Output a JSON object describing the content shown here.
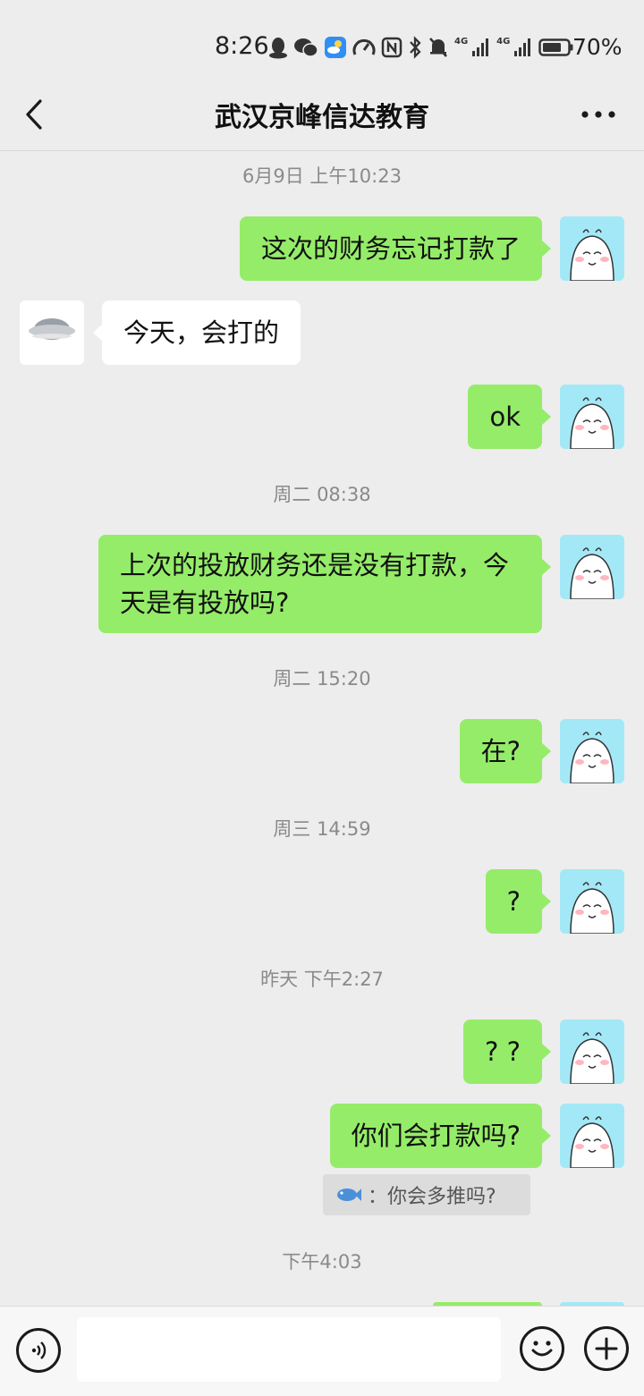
{
  "status_bar": {
    "time": "8:26",
    "network_4g_1": "4G",
    "network_4g_2": "4G",
    "battery_percent": "70%",
    "icons": [
      "qq-icon",
      "wechat-icon",
      "weather-app-icon",
      "speedometer-icon",
      "nfc-icon",
      "bluetooth-icon",
      "mute-bell-icon",
      "signal-icon",
      "signal-icon",
      "battery-icon"
    ]
  },
  "header": {
    "title": "武汉京峰信达教育",
    "back_icon": "chevron-left-icon",
    "more_icon": "more-dots-icon"
  },
  "messages": {
    "ts1": "6月9日 上午10:23",
    "m1": "这次的财务忘记打款了",
    "m2": "今天，会打的",
    "m3": "ok",
    "ts2": "周二 08:38",
    "m4_line1": "上次的投放财务还是没有打款，今",
    "m4_line2": "天是有投放吗?",
    "ts3": "周二 15:20",
    "m5": "在?",
    "ts4": "周三 14:59",
    "m6": "?",
    "ts5": "昨天 下午2:27",
    "m7": "? ?",
    "m8": "你们会打款吗?",
    "quote_sender_icon": "fish-icon",
    "quote_text": "：你会多推吗?",
    "ts6": "下午4:03"
  },
  "input_bar": {
    "value": "",
    "voice_icon": "voice-icon",
    "emoji_icon": "emoji-icon",
    "plus_icon": "plus-icon"
  },
  "colors": {
    "background": "#ededed",
    "my_bubble": "#95ec69",
    "their_bubble": "#ffffff",
    "timestamp": "#8a8a8a",
    "my_avatar_bg": "#a3e8f6"
  }
}
